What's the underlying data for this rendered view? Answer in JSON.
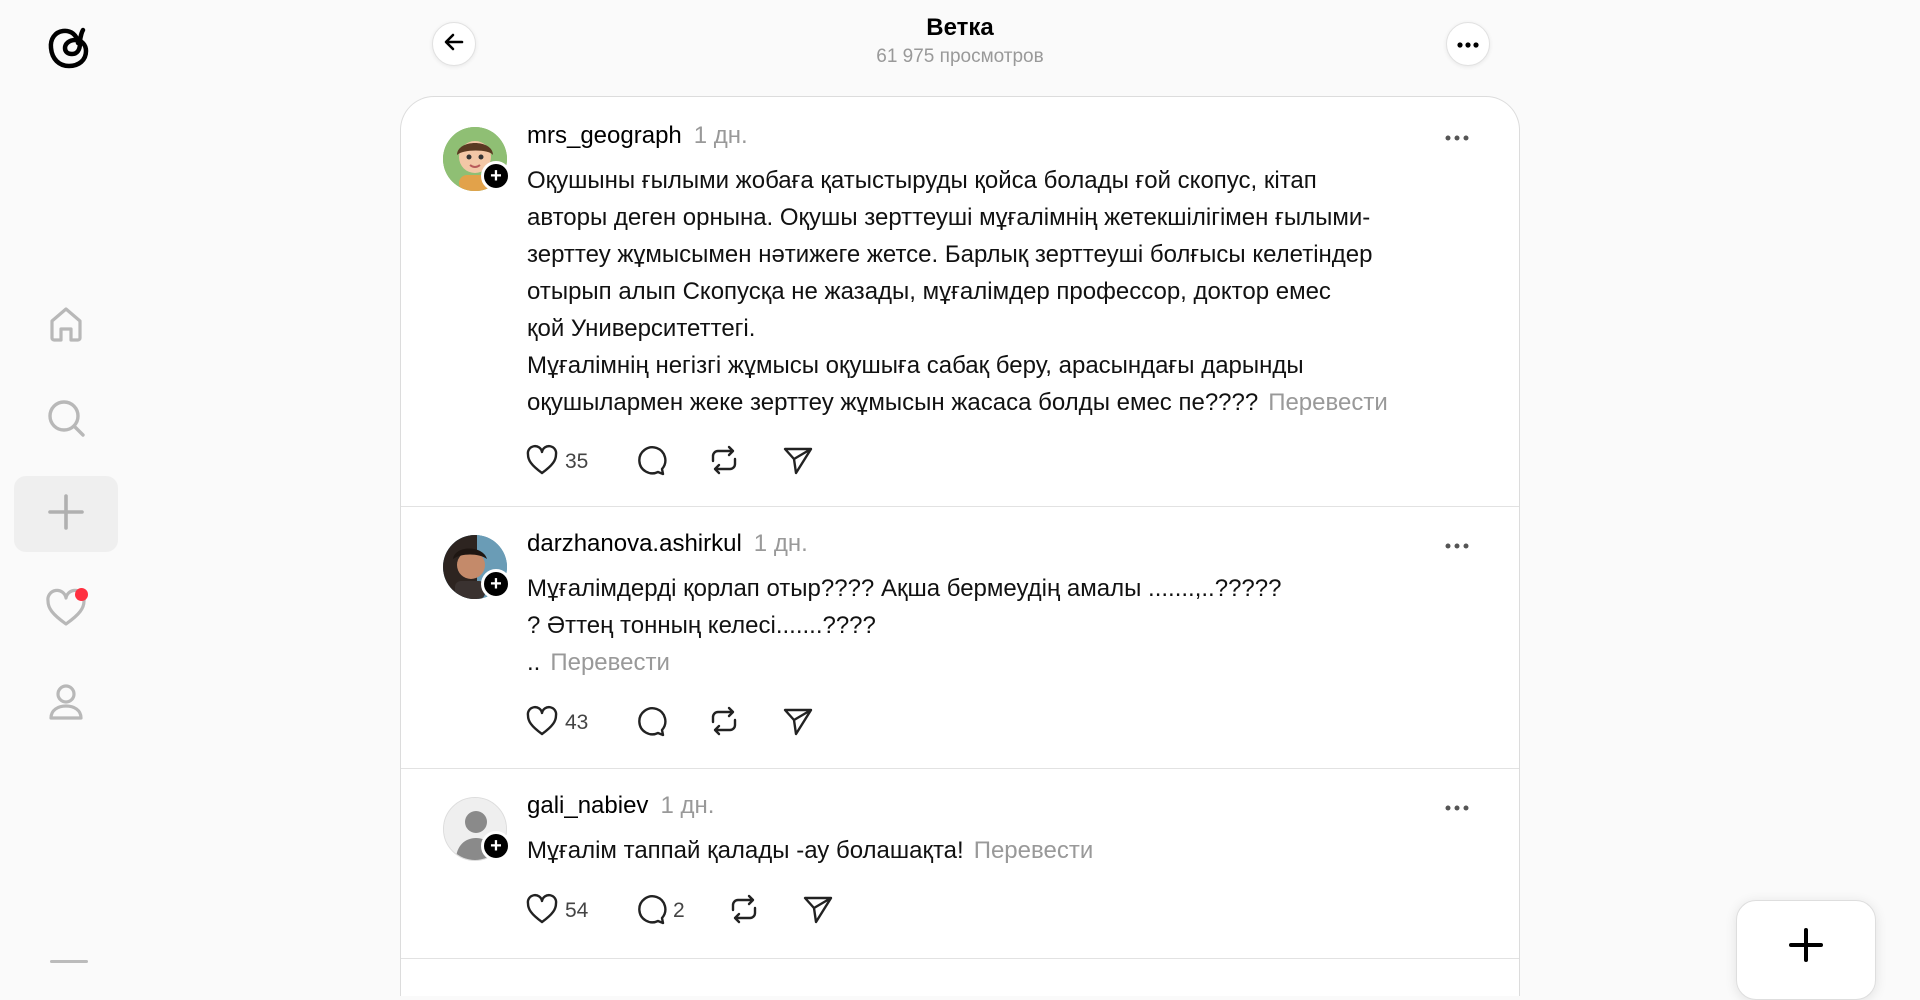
{
  "header": {
    "title": "Ветка",
    "views": "61 975 просмотров"
  },
  "sidebar": {
    "items": [
      {
        "name": "home",
        "icon": "home-icon"
      },
      {
        "name": "search",
        "icon": "search-icon"
      },
      {
        "name": "create",
        "icon": "plus-icon"
      },
      {
        "name": "activity",
        "icon": "heart-icon",
        "has_notification": true
      },
      {
        "name": "profile",
        "icon": "person-icon"
      }
    ],
    "notification_color": "#ff3040"
  },
  "posts": [
    {
      "username": "mrs_geograph",
      "time": "1 дн.",
      "lines": [
        "Оқушыны ғылыми жобаға қатыстыруды қойса болады ғой скопус, кітап",
        "авторы деген орнына. Оқушы зерттеуші мұғалімнің жетекшілігімен ғылыми-",
        "зерттеу жұмысымен нәтижеге жетсе. Барлық зерттеуші болғысы келетіндер",
        "отырып алып Скопусқа не жазады, мұғалімдер профессор, доктор емес",
        "қой Университеттегі.",
        "Мұғалімнің негізгі жұмысы оқушыға сабақ беру, арасындағы дарынды",
        "оқушылармен жеке зерттеу жұмысын жасаса болды емес пе????"
      ],
      "translate": "Перевести",
      "likes": "35",
      "replies": ""
    },
    {
      "username": "darzhanova.ashirkul",
      "time": "1 дн.",
      "lines": [
        "Мұғалімдерді қорлап отыр???? Ақша бермеудің амалы .......,..?????",
        "? Әттең тонның келесі.......????",
        ".."
      ],
      "translate": "Перевести",
      "likes": "43",
      "replies": ""
    },
    {
      "username": "gali_nabiev",
      "time": "1 дн.",
      "lines": [
        "Мұғалім таппай қалады -ау болашақта!"
      ],
      "translate": "Перевести",
      "likes": "54",
      "replies": "2"
    }
  ]
}
